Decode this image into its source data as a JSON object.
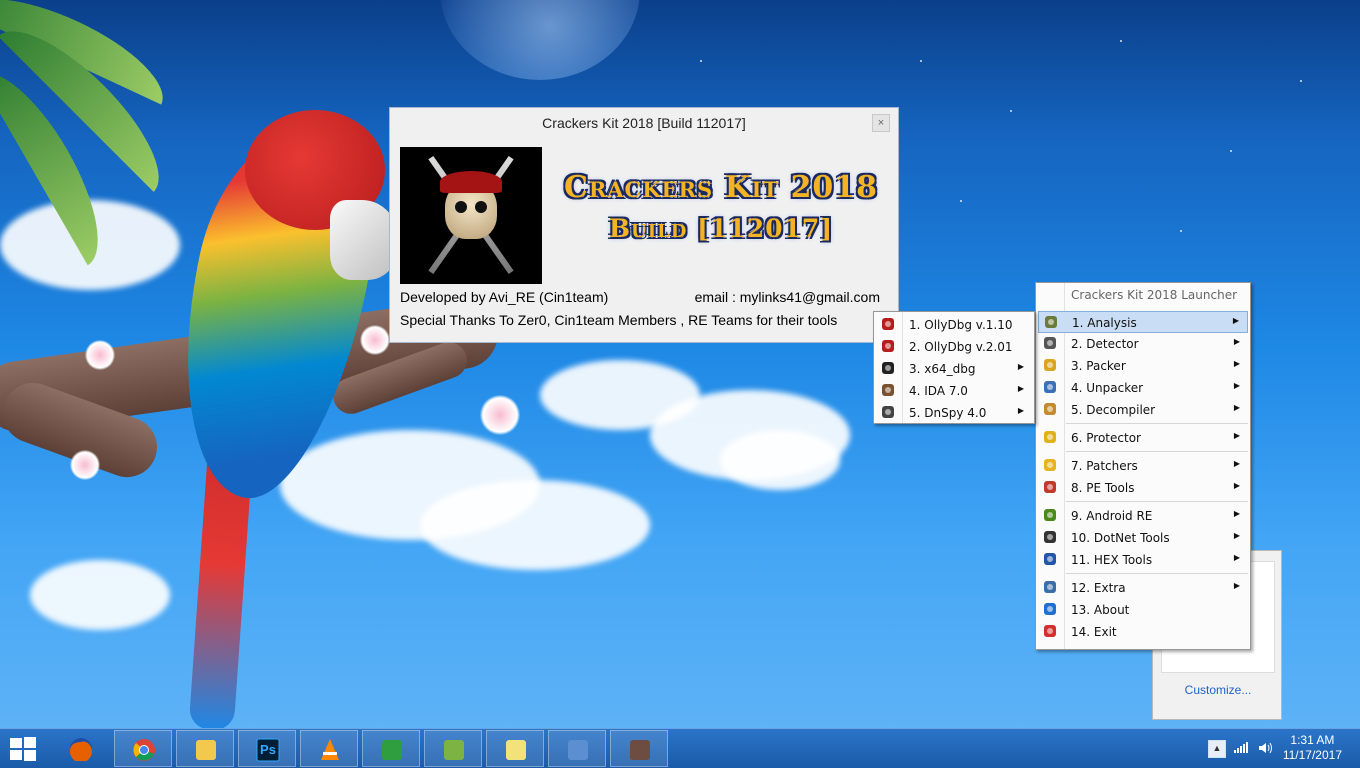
{
  "dialog": {
    "title": "Crackers Kit 2018 [Build 112017]",
    "close_label": "×",
    "logo_title": "Crackers Kit 2018",
    "logo_build": "Build [112017]",
    "developer": "Developed by Avi_RE (Cin1team)",
    "email": "email : mylinks41@gmail.com",
    "thanks": "Special Thanks To Zer0, Cin1team Members , RE Teams for their tools"
  },
  "launcher_menu": {
    "header": "Crackers Kit 2018 Launcher",
    "items": [
      {
        "label": "1. Analysis",
        "icon": "analysis-icon",
        "color": "#6b7b3a",
        "submenu": true,
        "highlighted": true
      },
      {
        "label": "2. Detector",
        "icon": "detector-icon",
        "color": "#555555",
        "submenu": true
      },
      {
        "label": "3. Packer",
        "icon": "packer-icon",
        "color": "#d9a520",
        "submenu": true
      },
      {
        "label": "4. Unpacker",
        "icon": "unpacker-icon",
        "color": "#3d6fb6",
        "submenu": true
      },
      {
        "label": "5. Decompiler",
        "icon": "decompiler-icon",
        "color": "#c58a2e",
        "submenu": true
      },
      {
        "label": "6. Protector",
        "icon": "protector-icon",
        "color": "#e0b21a",
        "submenu": true
      },
      {
        "label": "7. Patchers",
        "icon": "patchers-icon",
        "color": "#e6b422",
        "submenu": true
      },
      {
        "label": "8. PE Tools",
        "icon": "pe-tools-icon",
        "color": "#c0392b",
        "submenu": true
      },
      {
        "label": "9. Android RE",
        "icon": "android-icon",
        "color": "#4a8a1c",
        "submenu": true
      },
      {
        "label": "10. DotNet Tools",
        "icon": "dotnet-icon",
        "color": "#333333",
        "submenu": true
      },
      {
        "label": "11. HEX Tools",
        "icon": "hex-icon",
        "color": "#2255aa",
        "submenu": true
      },
      {
        "label": "12. Extra",
        "icon": "extra-icon",
        "color": "#3b6ea8",
        "submenu": true
      },
      {
        "label": "13. About",
        "icon": "info-icon",
        "color": "#1e6fd0",
        "submenu": false
      },
      {
        "label": "14. Exit",
        "icon": "exit-icon",
        "color": "#d32f2f",
        "submenu": false
      }
    ]
  },
  "analysis_menu": {
    "items": [
      {
        "label": "1. OllyDbg v.1.10",
        "icon": "bug-icon",
        "color": "#b71c1c",
        "submenu": false
      },
      {
        "label": "2. OllyDbg v.2.01",
        "icon": "bug-icon",
        "color": "#b71c1c",
        "submenu": false
      },
      {
        "label": "3. x64_dbg",
        "icon": "x64dbg-icon",
        "color": "#222222",
        "submenu": true
      },
      {
        "label": "4. IDA 7.0",
        "icon": "ida-icon",
        "color": "#7a5230",
        "submenu": true
      },
      {
        "label": "5. DnSpy 4.0",
        "icon": "dnspy-icon",
        "color": "#444444",
        "submenu": true
      }
    ]
  },
  "tray_popup": {
    "customize_label": "Customize..."
  },
  "taskbar": {
    "apps": [
      {
        "name": "firefox",
        "color": "#e66000"
      },
      {
        "name": "chrome",
        "color": "#db4437"
      },
      {
        "name": "file-explorer",
        "color": "#f2c94c"
      },
      {
        "name": "photoshop",
        "color": "#001e36",
        "label": "Ps"
      },
      {
        "name": "vlc",
        "color": "#ff8800"
      },
      {
        "name": "internet-download-manager",
        "color": "#2e9e3e"
      },
      {
        "name": "notepad-plus",
        "color": "#7cb342"
      },
      {
        "name": "sticky-notes",
        "color": "#f3e27a"
      },
      {
        "name": "control-panel",
        "color": "#5b8fd1"
      },
      {
        "name": "crackers-kit",
        "color": "#6d4c41"
      }
    ],
    "time": "1:31 AM",
    "date": "11/17/2017"
  }
}
